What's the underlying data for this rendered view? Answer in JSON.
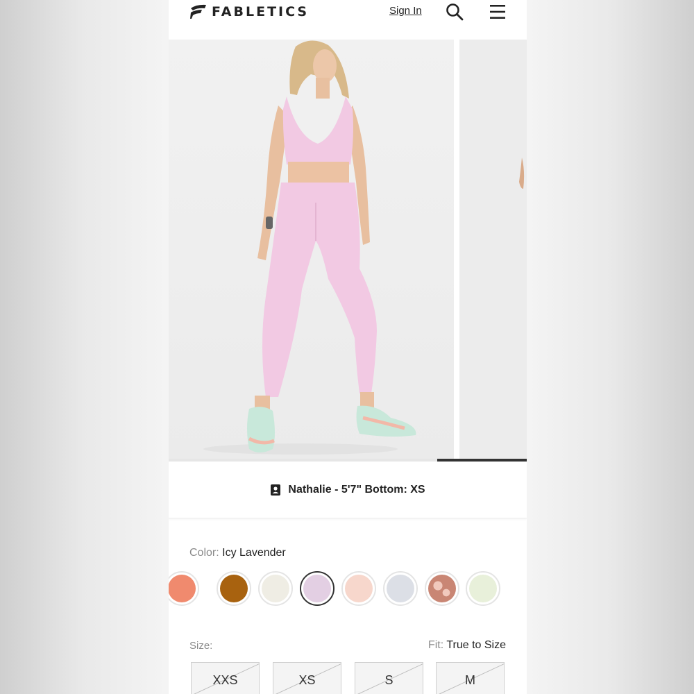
{
  "header": {
    "brand": "FABLETICS",
    "sign_in": "Sign In"
  },
  "model_info": {
    "text": "Nathalie - 5'7\" Bottom: XS"
  },
  "color": {
    "label": "Color:",
    "selected": "Icy Lavender",
    "swatches": [
      {
        "hex": "#f08a6e"
      },
      {
        "hex": "#a8620f"
      },
      {
        "hex": "#efede4"
      },
      {
        "hex": "#e3cfe3"
      },
      {
        "hex": "#f7d7cc"
      },
      {
        "hex": "#dcdfe6"
      },
      {
        "hex": "#c98674"
      },
      {
        "hex": "#e8f0da"
      }
    ]
  },
  "size": {
    "label": "Size:",
    "fit_label": "Fit:",
    "fit_value": "True to Size",
    "options": [
      "XXS",
      "XS",
      "S",
      "M"
    ]
  },
  "colors": {
    "accent": "#222222",
    "muted": "#8a8a8a",
    "product": "#f2c9e3"
  }
}
